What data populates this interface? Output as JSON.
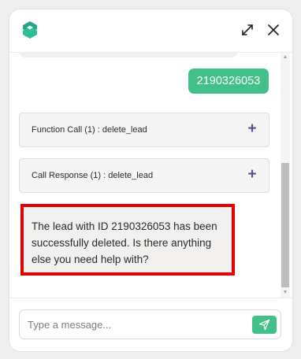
{
  "header": {
    "logo_icon": "brand-logo-icon",
    "expand_icon": "expand-icon",
    "close_icon": "close-icon"
  },
  "chat": {
    "user_message": "2190326053",
    "function_call": {
      "label": "Function Call (1) : delete_lead",
      "toggle": "+"
    },
    "call_response": {
      "label": "Call Response (1) : delete_lead",
      "toggle": "+"
    },
    "bot_message": "The lead with ID 2190326053 has been successfully deleted. Is there anything else you need help with?"
  },
  "composer": {
    "placeholder": "Type a message...",
    "value": "",
    "send_icon": "send-icon"
  },
  "colors": {
    "accent": "#42c08a",
    "highlight_border": "#e30000",
    "plus": "#5b4a98"
  }
}
